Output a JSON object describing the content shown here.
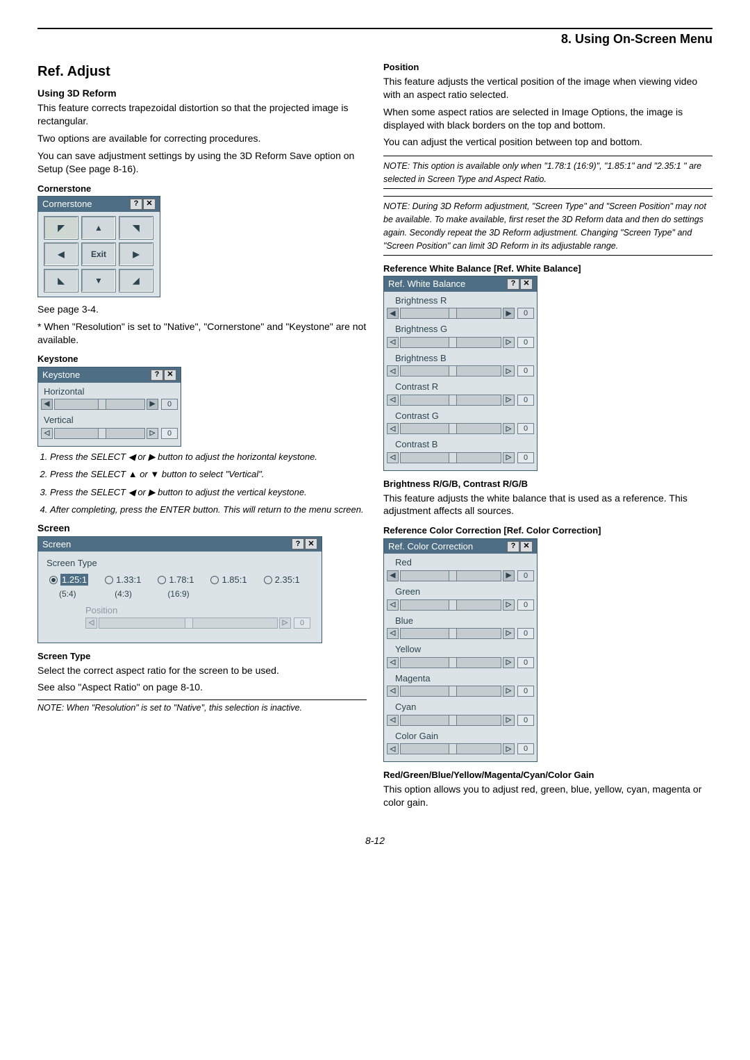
{
  "header": {
    "chapter": "8. Using On-Screen Menu"
  },
  "page_number": "8-12",
  "left": {
    "title": "Ref. Adjust",
    "h_3dreform": "Using 3D Reform",
    "p_3dreform_1": "This feature corrects trapezoidal distortion so that the projected image is rectangular.",
    "p_3dreform_2": "Two options are available for correcting procedures.",
    "p_3dreform_3": "You can save adjustment settings by using the 3D Reform Save option on Setup (See page 8-16).",
    "h_corner": "Cornerstone",
    "dlg_corner_title": "Cornerstone",
    "exit": "Exit",
    "see_page": "See page 3-4.",
    "corner_note": "* When \"Resolution\" is set to \"Native\", \"Cornerstone\" and \"Keystone\" are not available.",
    "h_keystone": "Keystone",
    "dlg_keystone_title": "Keystone",
    "ks_h": "Horizontal",
    "ks_v": "Vertical",
    "ks_val": "0",
    "steps": [
      "Press the SELECT ◀ or ▶ button to adjust the horizontal keystone.",
      "Press the SELECT ▲ or ▼ button to select \"Vertical\".",
      "Press the SELECT ◀ or ▶ button to adjust the vertical keystone.",
      "After completing, press the ENTER button. This will return to the menu screen."
    ],
    "h_screen": "Screen",
    "dlg_screen_title": "Screen",
    "screen_type_label": "Screen Type",
    "ratios": [
      {
        "r": "1.25:1",
        "s": "(5:4)",
        "sel": true
      },
      {
        "r": "1.33:1",
        "s": "(4:3)",
        "sel": false
      },
      {
        "r": "1.78:1",
        "s": "(16:9)",
        "sel": false
      },
      {
        "r": "1.85:1",
        "s": "",
        "sel": false
      },
      {
        "r": "2.35:1",
        "s": "",
        "sel": false
      }
    ],
    "position_label": "Position",
    "pos_val": "0",
    "h_screen_type": "Screen Type",
    "p_screen_type_1": "Select the correct aspect ratio for the screen to be used.",
    "p_screen_type_2": "See also \"Aspect Ratio\" on page 8-10.",
    "screen_type_note": "NOTE: When \"Resolution\" is set to \"Native\", this selection is inactive."
  },
  "right": {
    "h_position": "Position",
    "p_position_1": "This feature adjusts the vertical position of the image when viewing video with an aspect ratio selected.",
    "p_position_2": "When some aspect ratios are selected in Image Options, the image is displayed with black borders on the top and bottom.",
    "p_position_3": "You can adjust the vertical position between top and bottom.",
    "note1": "NOTE: This option is available only when \"1.78:1 (16:9)\", \"1.85:1\" and \"2.35:1 \" are selected in Screen Type and Aspect Ratio.",
    "note2": "NOTE: During 3D Reform adjustment, \"Screen Type\" and \"Screen Position\" may not be available. To make available, first reset the 3D Reform data and then do settings again. Secondly repeat the 3D Reform adjustment. Changing \"Screen Type\" and \"Screen Position\" can limit 3D Reform in its adjustable range.",
    "h_wb": "Reference White Balance [Ref. White Balance]",
    "dlg_wb_title": "Ref. White Balance",
    "wb_items": [
      "Brightness R",
      "Brightness G",
      "Brightness B",
      "Contrast R",
      "Contrast G",
      "Contrast B"
    ],
    "wb_val": "0",
    "h_brc": "Brightness R/G/B, Contrast R/G/B",
    "p_brc": "This feature adjusts the white balance that is used as a reference. This adjustment affects all sources.",
    "h_cc": "Reference Color Correction [Ref. Color Correction]",
    "dlg_cc_title": "Ref. Color Correction",
    "cc_items": [
      "Red",
      "Green",
      "Blue",
      "Yellow",
      "Magenta",
      "Cyan",
      "Color Gain"
    ],
    "cc_val": "0",
    "h_rgbymc": "Red/Green/Blue/Yellow/Magenta/Cyan/Color Gain",
    "p_rgbymc": "This option allows you to adjust red, green, blue, yellow, cyan, magenta or color gain."
  },
  "icons": {
    "help": "?",
    "close": "✕",
    "left": "◀",
    "right": "▶",
    "up": "▲",
    "down": "▼"
  }
}
